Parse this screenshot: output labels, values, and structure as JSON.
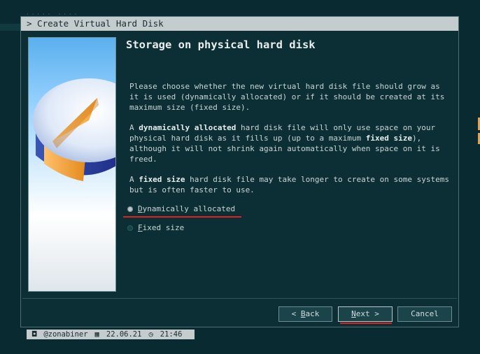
{
  "window": {
    "title": "> Create Virtual Hard Disk"
  },
  "page": {
    "heading": "Storage on physical hard disk",
    "para1": "Please choose whether the new virtual hard disk file should grow as it is used (dynamically allocated) or if it should be created at its maximum size (fixed size).",
    "para2_prefix": "A ",
    "para2_bold1": "dynamically allocated",
    "para2_mid": " hard disk file will only use space on your physical hard disk as it fills up (up to a maximum ",
    "para2_bold2": "fixed size",
    "para2_suffix": "), although it will not shrink again automatically when space on it is freed.",
    "para3_prefix": "A ",
    "para3_bold": "fixed size",
    "para3_suffix": " hard disk file may take longer to create on some systems but is often faster to use."
  },
  "options": {
    "dynamic_mnemonic": "D",
    "dynamic_rest": "ynamically allocated",
    "dynamic_selected": true,
    "fixed_mnemonic": "F",
    "fixed_rest": "ixed size",
    "fixed_selected": false
  },
  "buttons": {
    "back_prefix": "< ",
    "back_mnemonic": "B",
    "back_rest": "ack",
    "next_mnemonic": "N",
    "next_rest": "ext >",
    "cancel": "Cancel"
  },
  "statusbar": {
    "user": "@zonabiner",
    "date": "22.06.21",
    "time": "21:46"
  },
  "colors": {
    "background": "#082a30",
    "window": "#0b2f35",
    "titlebar": "#c4cccd",
    "annotation": "#e0201c"
  }
}
